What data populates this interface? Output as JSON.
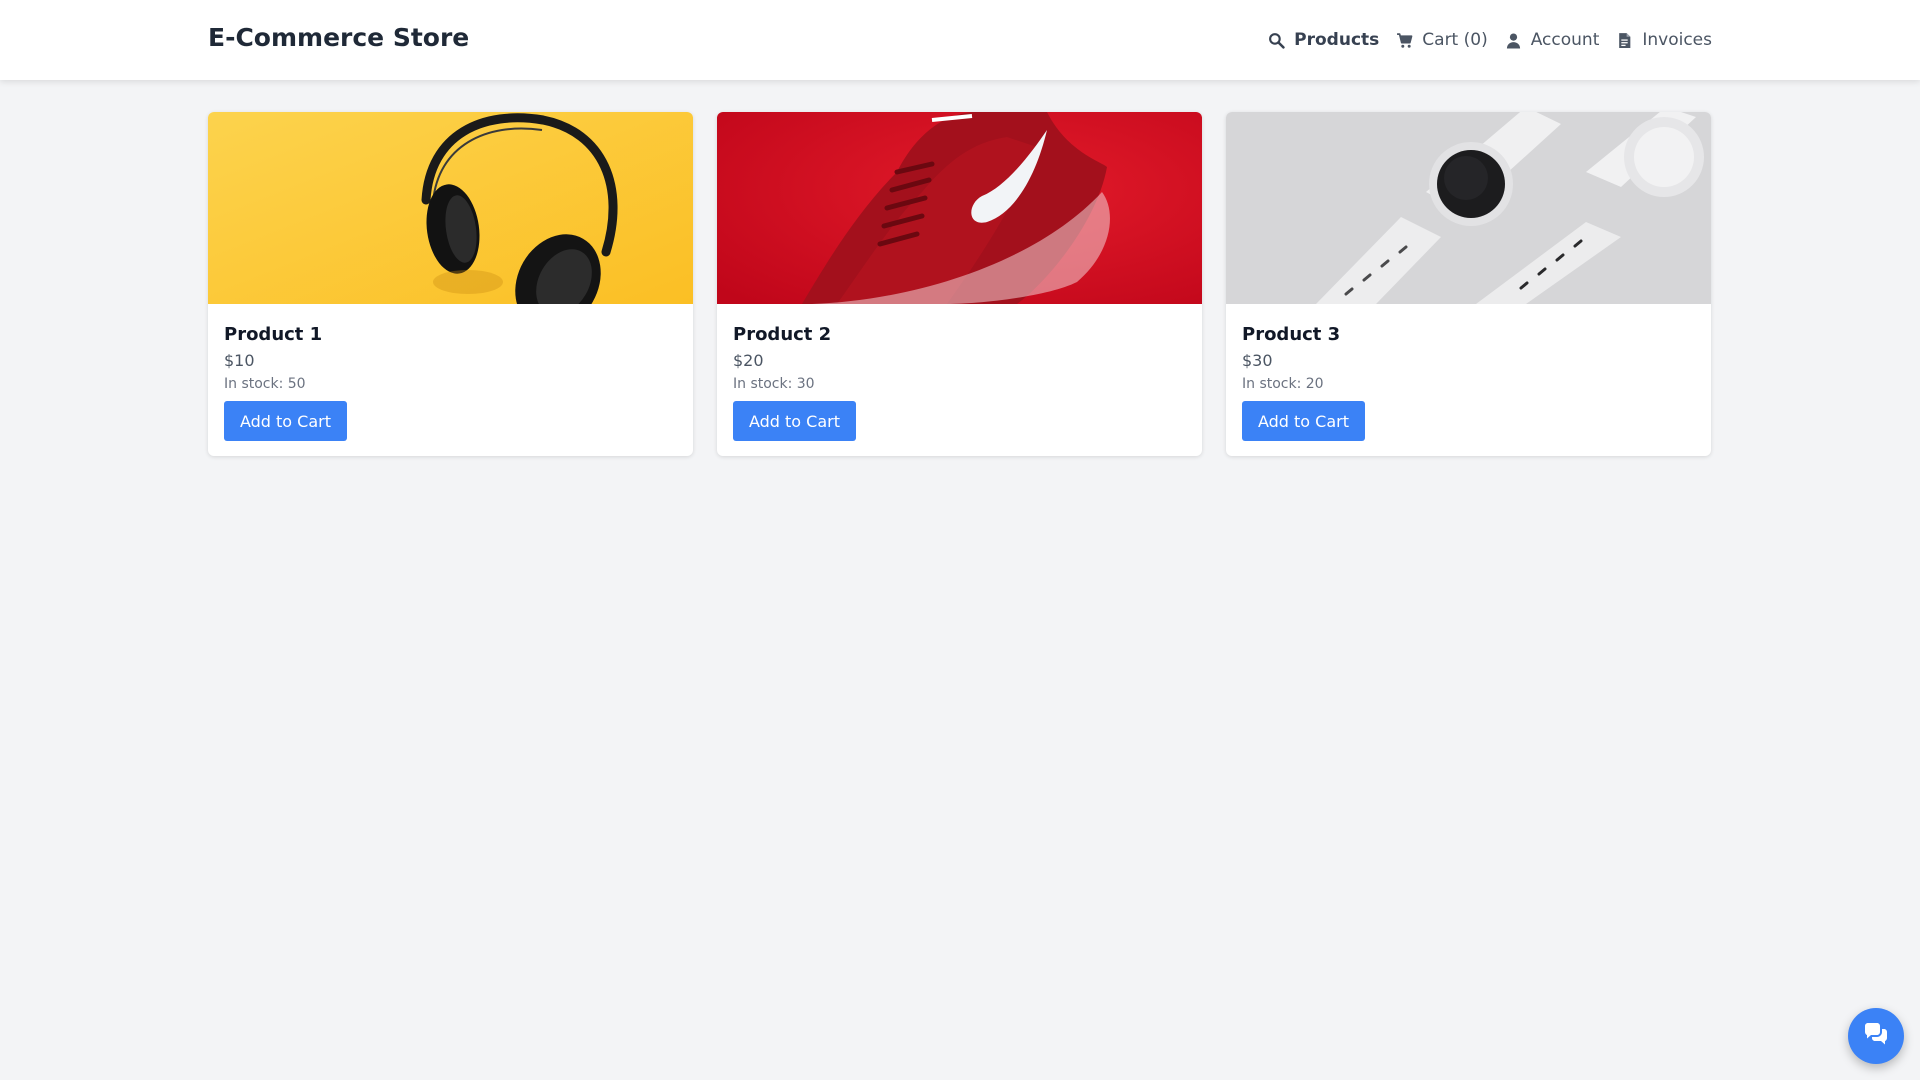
{
  "header": {
    "title": "E-Commerce Store",
    "nav": [
      {
        "label": "Products",
        "icon": "search-icon",
        "active": true
      },
      {
        "label": "Cart (0)",
        "icon": "cart-icon",
        "active": false
      },
      {
        "label": "Account",
        "icon": "user-icon",
        "active": false
      },
      {
        "label": "Invoices",
        "icon": "invoice-icon",
        "active": false
      }
    ]
  },
  "products": [
    {
      "name": "Product 1",
      "price": "$10",
      "stock": "In stock: 50",
      "button": "Add to Cart",
      "image": "headphones-image"
    },
    {
      "name": "Product 2",
      "price": "$20",
      "stock": "In stock: 30",
      "button": "Add to Cart",
      "image": "sneaker-image"
    },
    {
      "name": "Product 3",
      "price": "$30",
      "stock": "In stock: 20",
      "button": "Add to Cart",
      "image": "watch-image"
    }
  ],
  "chat": {
    "icon": "chat-bubbles-icon"
  },
  "colors": {
    "accent": "#3b82f6",
    "background": "#f3f4f6",
    "navbar": "#ffffff",
    "headphones_bg": "#fbbf24",
    "sneaker_bg": "#dc0a1e",
    "watch_bg": "#d4d4d6"
  }
}
